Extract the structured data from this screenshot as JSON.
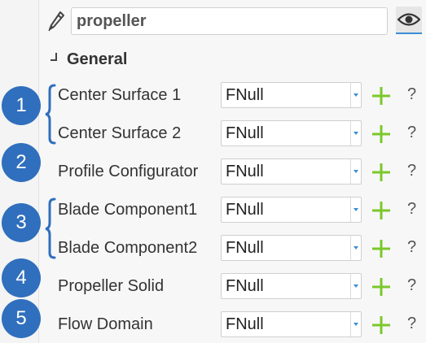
{
  "colors": {
    "accent": "#2f6fbd",
    "add_green": "#7bc82a",
    "eye_underline": "#3a8ed6"
  },
  "icons": {
    "pen": "pen-icon",
    "eye": "eye-icon",
    "add": "plus-icon",
    "dropdown": "chevron-down-icon",
    "section": "collapse-arrow-icon"
  },
  "header": {
    "name_value": "propeller"
  },
  "section": {
    "title": "General"
  },
  "rows": [
    {
      "label": "Center Surface 1",
      "value": "FNull",
      "help": "?"
    },
    {
      "label": "Center Surface 2",
      "value": "FNull",
      "help": "?"
    },
    {
      "label": "Profile Configurator",
      "value": "FNull",
      "help": "?"
    },
    {
      "label": "Blade Component1",
      "value": "FNull",
      "help": "?"
    },
    {
      "label": "Blade Component2",
      "value": "FNull",
      "help": "?"
    },
    {
      "label": "Propeller Solid",
      "value": "FNull",
      "help": "?"
    },
    {
      "label": "Flow Domain",
      "value": "FNull",
      "help": "?"
    }
  ],
  "badges": [
    "1",
    "2",
    "3",
    "4",
    "5"
  ]
}
